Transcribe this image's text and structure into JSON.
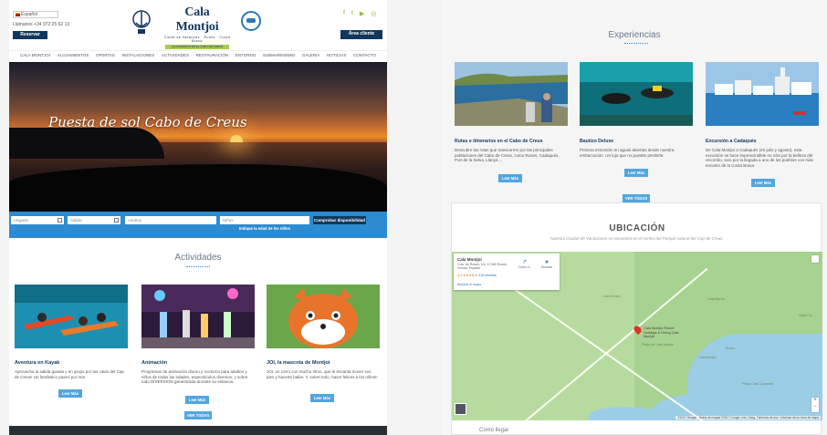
{
  "header": {
    "language": "Español",
    "phone": "Llámanos +34 972 25 62 13",
    "reserve_button": "Reservar",
    "area_button": "Área cliente",
    "brand_name": "Cala Montjoi",
    "brand_tagline": "Ciutat de Vacances · Roses · Costa Brava",
    "brand_subtag": "ALOJAMIENTO EN EL CABO DE CREUS",
    "social_icons": [
      "facebook-icon",
      "twitter-icon",
      "youtube-icon",
      "instagram-icon"
    ],
    "social_glyphs": [
      "f",
      "t",
      "▶",
      "◎"
    ]
  },
  "nav": [
    "CALA MONTJOI",
    "ALOJAMIENTOS",
    "OFERTAS",
    "INSTALACIONES",
    "ACTIVIDADES",
    "RESTAURACIÓN",
    "ENTORNO",
    "SUBMARINISMO",
    "GALERÍA",
    "NOTICIAS",
    "CONTACTO"
  ],
  "hero": {
    "title": "Puesta de sol Cabo de Creus"
  },
  "search": {
    "checkin": "Llegada",
    "checkout": "Salida",
    "adults": "Adultos",
    "kids": "Niños",
    "submit": "Comprobar disponibilidad",
    "kids_note": "Indique la edad de los niños"
  },
  "activities": {
    "title": "Actividades",
    "items": [
      {
        "title": "Aventura en Kayak",
        "desc": "Aprovecha la salida guiada y en grupo por las calas del Cap de Creus! Un fantástico paseo por mar",
        "button": "Leer Más"
      },
      {
        "title": "Animación",
        "desc": "Programas de animación diurno y nocturno para adultos y niños de todas las edades, espectáculos diversos, y sobre todo DIVERSIÓN garantizada durante su estancia.",
        "button": "Leer Más"
      },
      {
        "title": "JOI, la mascota de Montjoi",
        "desc": "JOI, un zorro con mucho ritmo, que le encanta mover sus pies y hacerte bailar. Y, sobre todo, hacer felices a los niños!!",
        "button": "Leer Más"
      }
    ],
    "all_button": "VER TODAS"
  },
  "experiences": {
    "title": "Experiencias",
    "items": [
      {
        "title": "Rutas e itinerarios en el Cabo de Creus",
        "desc": "Descubre las rutas que transcurren por las principales poblaciones del Cabo de Creus, como Roses, Cadaqués, Port de la Selva, Llançà ...",
        "button": "Leer Más"
      },
      {
        "title": "Bautizo Deluxe",
        "desc": "Primera inmersión en aguas abiertas desde nuestra embarcación. Un lujo que no puedes perderte.",
        "button": "Leer Más"
      },
      {
        "title": "Excursión a Cadaqués",
        "desc": "De Cala Montjoi a Cadaqués (en julio y agosto), esta excursión se hace imprescindible no sólo por la belleza del recorrido, sino por la llegada a uno de los pueblos con más encanto de la Costa Brava",
        "button": "Leer Más"
      }
    ],
    "all_button": "VER TODAS"
  },
  "location": {
    "title": "UBICACIÓN",
    "subtitle": "Nuestra Ciudad de Vacaciones se encuentra en el centro del Parque natural del Cap de Creus.",
    "place_name": "Cala Montjoi",
    "place_address": "Crta. de Roses, s/n, 17480 Roses, Girona, España",
    "rating": "4,3 ★★★★★",
    "reviews": "316 reseñas",
    "directions": "Cómo ll...",
    "save": "Guardar",
    "enlarge": "Ampliar el mapa",
    "pin_label": "Cala Montjoi Resort Holidays & Diving Cala Montjoi",
    "map_labels": [
      "Cala Montjoi",
      "Cala Murtra",
      "Platja de Cala Montjoi",
      "Platja Cala Canyelles",
      "Hotel Ca...",
      "Cala Montjoi",
      "Roses"
    ],
    "footer": "©2017 Google · Datos de mapas ©2017 Google, Inst. Geog. Términos de uso · Informar de un error de mapa",
    "next_heading": "Como llegar"
  }
}
